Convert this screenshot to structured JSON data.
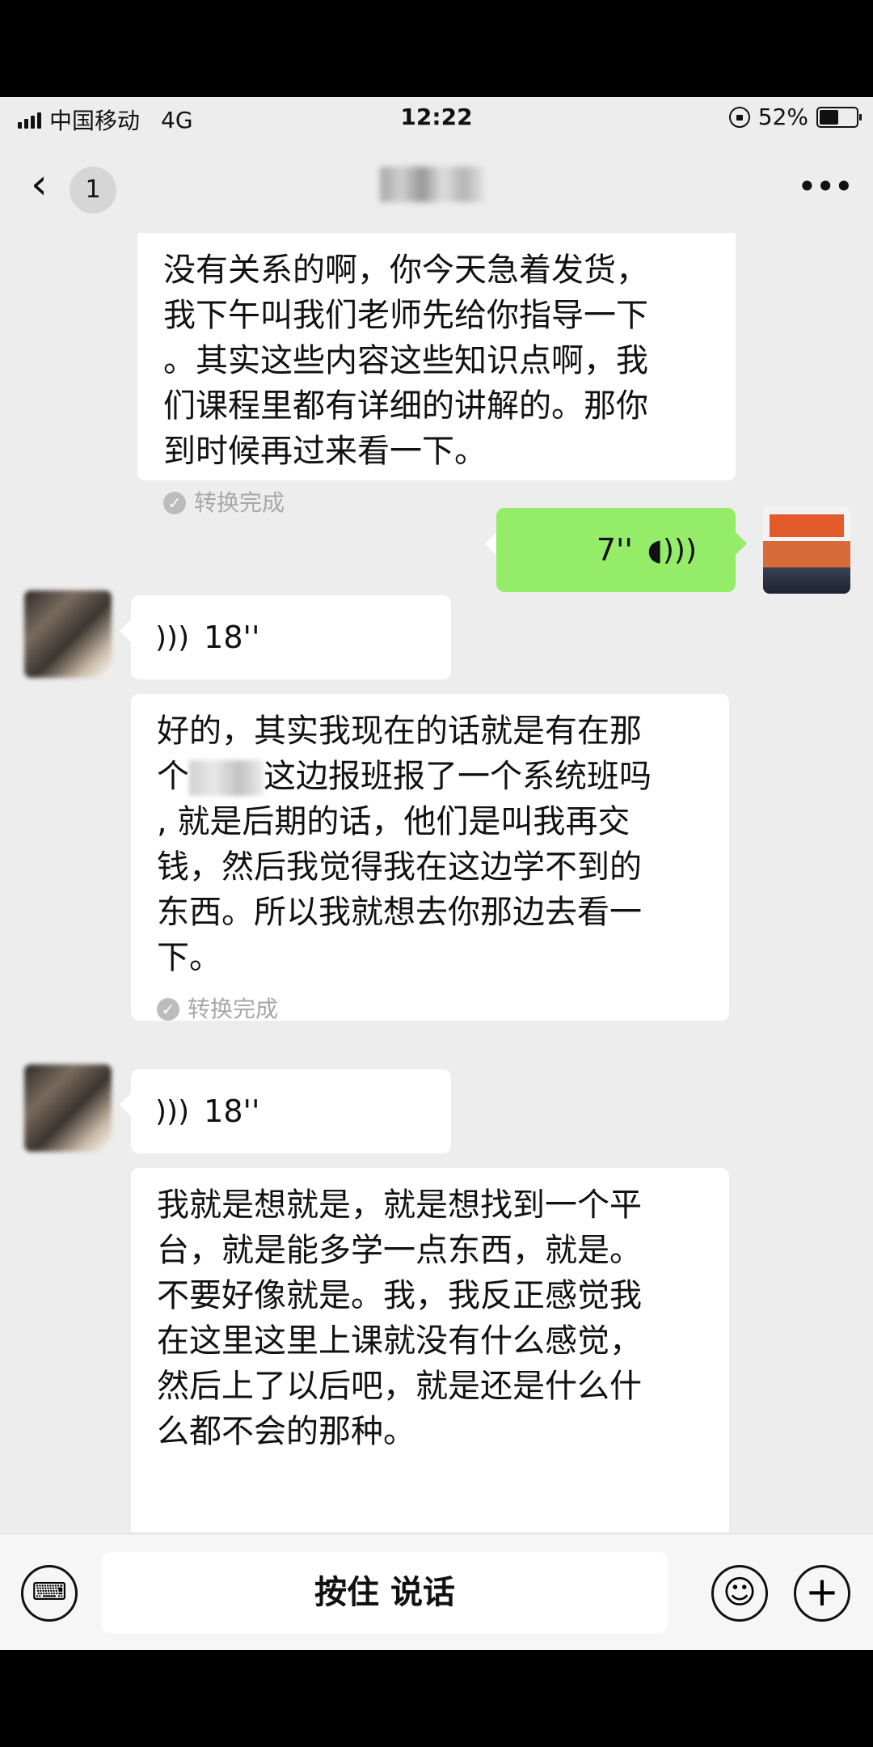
{
  "status_bar": {
    "carrier": "中国移动",
    "network": "4G",
    "time": "12:22",
    "battery_percent": "52%",
    "battery_level": 0.52
  },
  "nav": {
    "back_icon": "chevron-left-icon",
    "unread_count": "1",
    "more_label": "•••"
  },
  "messages": [
    {
      "side": "left",
      "type": "voice-text",
      "lines": [
        "没有关系的啊，你今天急着发货，",
        "我下午叫我们老师先给你指导一下",
        "。其实这些内容这些知识点啊，我",
        "们课程里都有详细的讲解的。那你",
        "到时候再过来看一下。"
      ],
      "convert_status": "转换完成"
    },
    {
      "side": "right",
      "type": "voice",
      "duration": "7''"
    },
    {
      "side": "left",
      "type": "voice",
      "duration": "18''"
    },
    {
      "side": "left",
      "type": "voice-text",
      "lines_before": "好的，其实我现在的话就是有在那",
      "line2_prefix": "个",
      "line2_suffix": "这边报班报了一个系统班吗",
      "lines": [
        ", 就是后期的话，他们是叫我再交",
        "钱，然后我觉得我在这边学不到的",
        "东西。所以我就想去你那边去看一",
        "下。"
      ],
      "convert_status": "转换完成"
    },
    {
      "side": "left",
      "type": "voice",
      "duration": "18''"
    },
    {
      "side": "left",
      "type": "voice-text",
      "lines": [
        "我就是想就是，就是想找到一个平",
        "台，就是能多学一点东西，就是。",
        "不要好像就是。我，我反正感觉我",
        "在这里这里上课就没有什么感觉，",
        "然后上了以后吧，就是还是什么什",
        "么都不会的那种。"
      ]
    }
  ],
  "input_bar": {
    "talk_label": "按住 说话",
    "keyboard_icon": "keyboard-icon",
    "emoji_icon": "emoji-icon",
    "plus_icon": "plus-icon"
  }
}
